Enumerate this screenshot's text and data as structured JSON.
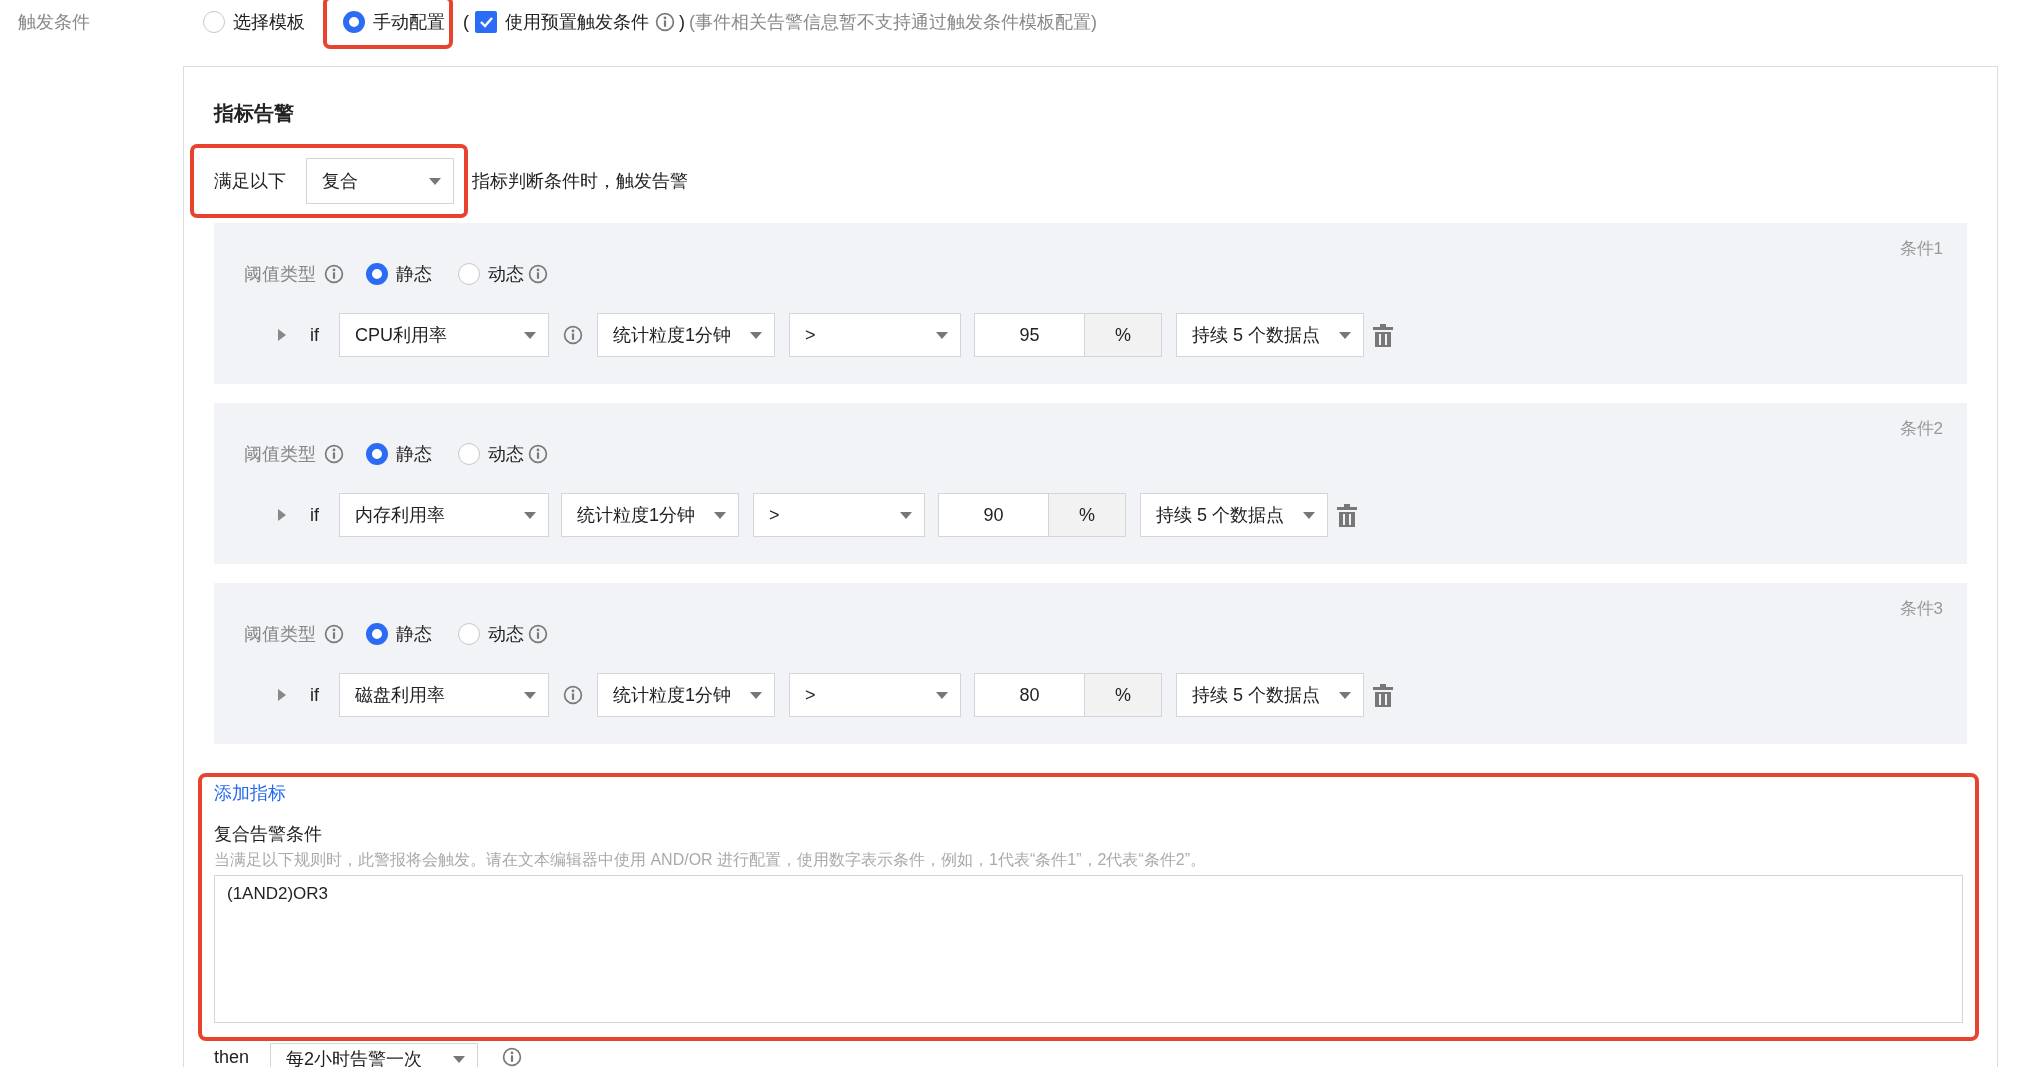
{
  "trigger": {
    "label": "触发条件",
    "options": [
      {
        "label": "选择模板",
        "selected": false,
        "highlighted": false
      },
      {
        "label": "手动配置",
        "selected": true,
        "highlighted": true
      }
    ],
    "preset": {
      "open": "(",
      "label": "使用预置触发条件",
      "checked": true,
      "close": ")",
      "note": "(事件相关告警信息暂不支持通过触发条件模板配置)"
    }
  },
  "section_title": "指标告警",
  "match": {
    "prefix": "满足以下",
    "value": "复合",
    "suffix": "指标判断条件时，触发告警",
    "highlighted": true
  },
  "conditions": [
    {
      "name": "条件1",
      "threshold_label": "阈值类型",
      "threshold_types": [
        {
          "label": "静态",
          "selected": true,
          "info": false
        },
        {
          "label": "动态",
          "selected": false,
          "info": true
        }
      ],
      "if": "if",
      "metric": "CPU利用率",
      "metric_info": true,
      "period": "统计粒度1分钟",
      "operator": ">",
      "value": "95",
      "unit": "%",
      "duration": "持续 5 个数据点"
    },
    {
      "name": "条件2",
      "threshold_label": "阈值类型",
      "threshold_types": [
        {
          "label": "静态",
          "selected": true,
          "info": false
        },
        {
          "label": "动态",
          "selected": false,
          "info": true
        }
      ],
      "if": "if",
      "metric": "内存利用率",
      "metric_info": false,
      "period": "统计粒度1分钟",
      "operator": ">",
      "value": "90",
      "unit": "%",
      "duration": "持续 5 个数据点"
    },
    {
      "name": "条件3",
      "threshold_label": "阈值类型",
      "threshold_types": [
        {
          "label": "静态",
          "selected": true,
          "info": false
        },
        {
          "label": "动态",
          "selected": false,
          "info": true
        }
      ],
      "if": "if",
      "metric": "磁盘利用率",
      "metric_info": true,
      "period": "统计粒度1分钟",
      "operator": ">",
      "value": "80",
      "unit": "%",
      "duration": "持续 5 个数据点"
    }
  ],
  "composite": {
    "highlighted": true,
    "add_link": "添加指标",
    "title": "复合告警条件",
    "hint": "当满足以下规则时，此警报将会触发。请在文本编辑器中使用 AND/OR 进行配置，使用数字表示条件，例如，1代表“条件1”，2代表“条件2”。",
    "expression": "(1AND2)OR3"
  },
  "then": {
    "label": "then",
    "value": "每2小时告警一次"
  }
}
